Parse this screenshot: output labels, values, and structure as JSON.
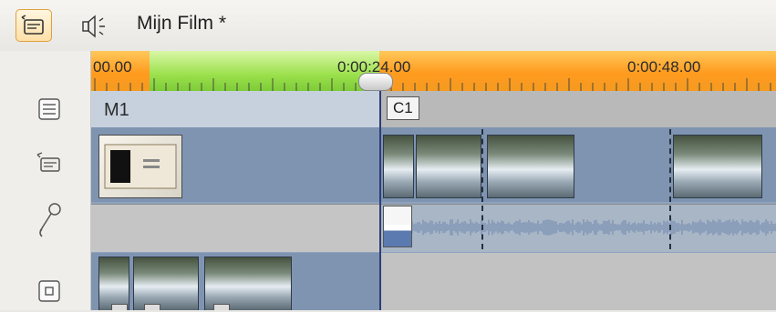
{
  "header": {
    "title": "Mijn Film *",
    "timeline_view_icon": "timeline-view-icon",
    "audio_view_icon": "audio-speaker-icon"
  },
  "left_toolbar": {
    "items": [
      {
        "name": "menu-list-icon"
      },
      {
        "name": "video-track-icon"
      },
      {
        "name": "microphone-icon"
      },
      {
        "name": "square-track-icon"
      }
    ]
  },
  "timeline": {
    "ruler": {
      "labels": [
        "00.00",
        "0:00:24.00",
        "0:00:48.00"
      ]
    },
    "menu_track": {
      "marker_left": "M1",
      "marker_right": "C1"
    }
  },
  "colors": {
    "ruler_orange": "#ff9b1f",
    "ruler_green": "#9be04c",
    "track_blue": "#7f94b1",
    "accent_border": "#e0a040"
  }
}
